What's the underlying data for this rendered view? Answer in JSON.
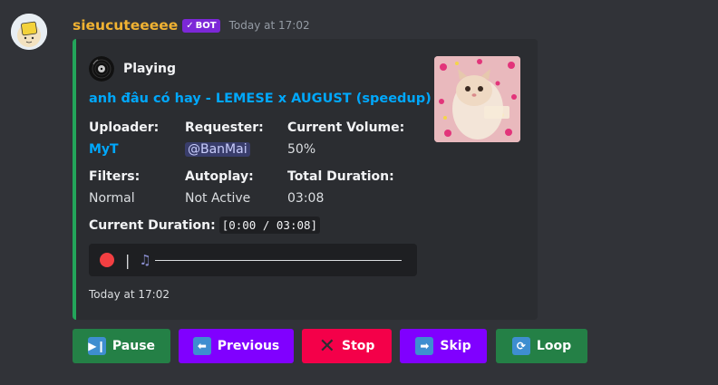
{
  "message": {
    "username": "sieucuteeeee",
    "bot_badge": "BOT",
    "timestamp": "Today at 17:02"
  },
  "embed": {
    "accent_color": "#23a55a",
    "author": "Playing",
    "title": "anh đâu có hay - LEMESE x AUGUST (speedup)",
    "fields": {
      "uploader": {
        "name": "Uploader:",
        "value": "MyT"
      },
      "requester": {
        "name": "Requester:",
        "value": "@BanMai"
      },
      "volume": {
        "name": "Current Volume:",
        "value": "50%"
      },
      "filters": {
        "name": "Filters:",
        "value": "Normal"
      },
      "autoplay": {
        "name": "Autoplay:",
        "value": "Not Active"
      },
      "total_duration": {
        "name": "Total Duration:",
        "value": "03:08"
      }
    },
    "current_duration": {
      "label": "Current Duration:",
      "value": "[0:00 / 03:08]"
    },
    "progress": {
      "fraction": 0.0,
      "icons": [
        "record-dot-icon",
        "music-note-icon"
      ]
    },
    "footer": "Today at 17:02"
  },
  "buttons": {
    "pause": {
      "label": "Pause",
      "color": "#248046",
      "icon": "play-pause-icon"
    },
    "previous": {
      "label": "Previous",
      "color": "#8000ff",
      "icon": "arrow-left-icon"
    },
    "stop": {
      "label": "Stop",
      "color": "#f40049",
      "icon": "cross-mark-icon"
    },
    "skip": {
      "label": "Skip",
      "color": "#8000ff",
      "icon": "arrow-right-icon"
    },
    "loop": {
      "label": "Loop",
      "color": "#248046",
      "icon": "repeat-icon"
    }
  }
}
